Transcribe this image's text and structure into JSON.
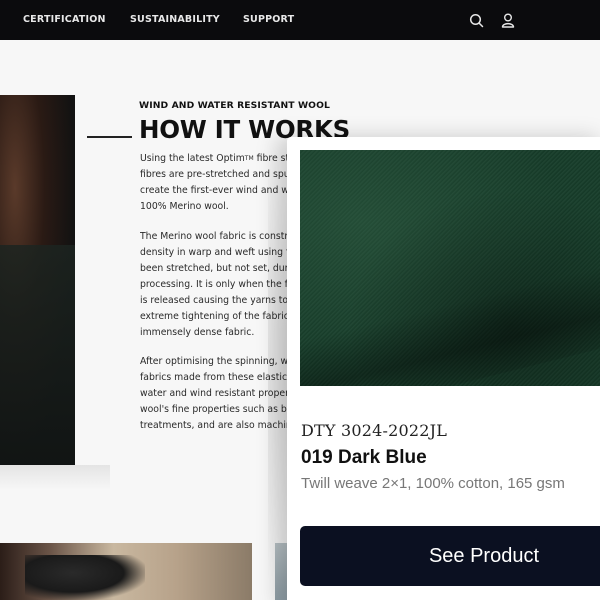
{
  "nav": {
    "items": [
      "CERTIFICATION",
      "SUSTAINABILITY",
      "SUPPORT"
    ],
    "icons": [
      "search-icon",
      "user-icon"
    ]
  },
  "article": {
    "eyebrow": "WIND AND WATER RESISTANT WOOL",
    "headline": "HOW IT WORKS",
    "paragraph_1": {
      "lines": [
        "Using the latest Optim",
        "fibres are pre-stretched and spun in",
        "create the first-ever wind and water",
        "100% Merino wool."
      ],
      "trademark": "TM",
      "line1_tail": " fibre stretched"
    },
    "paragraph_2": {
      "lines": [
        "The Merino wool fabric is construct",
        "density in warp and weft using fine",
        "been stretched, but not set, during",
        "processing. It is only when the fabri",
        "is released causing the yarns to con",
        "extreme tightening of the fabric stru",
        "immensely dense fabric."
      ]
    },
    "paragraph_3": {
      "lines": [
        "After optimising the spinning, weav",
        "fabrics made from these elastic Mer",
        "water and wind resistant properties",
        "wool's fine properties such as breat",
        "treatments, and are also machine w"
      ]
    }
  },
  "product_card": {
    "sku": "DTY 3024-2022JL",
    "name": "019 Dark Blue",
    "specs": "Twill weave 2×1, 100% cotton, 165 gsm",
    "swatch_color": "#173d2a",
    "cta_label": "See Product",
    "cta_color": "#0b1021"
  }
}
